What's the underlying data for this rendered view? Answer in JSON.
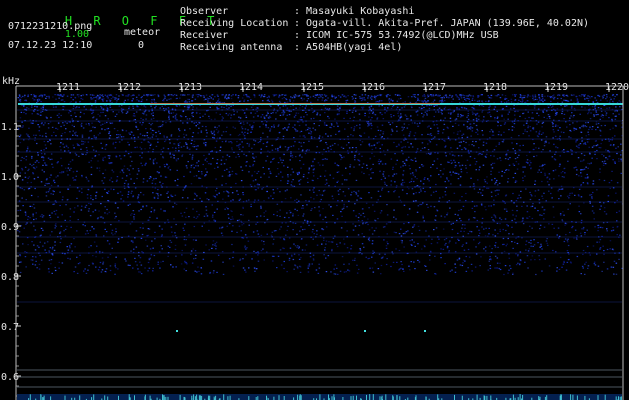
{
  "app": {
    "name": "H R O F F T",
    "version": "1.00"
  },
  "file": {
    "name": "0712231210.png",
    "datetime": "07.12.23 12:10"
  },
  "meteor": {
    "label": "meteor",
    "count": "0"
  },
  "info": [
    {
      "label": "Observer",
      "value": ": Masayuki Kobayashi"
    },
    {
      "label": "Receiving Location",
      "value": ": Ogata-vill. Akita-Pref. JAPAN (139.96E, 40.02N)"
    },
    {
      "label": "Receiver",
      "value": ": ICOM IC-575 53.7492(@LCD)MHz USB"
    },
    {
      "label": "Receiving antenna",
      "value": ": A504HB(yagi 4el)"
    }
  ],
  "axis": {
    "unit": "kHz",
    "time_ticks": [
      "1211",
      "1212",
      "1213",
      "1214",
      "1215",
      "1216",
      "1217",
      "1218",
      "1219",
      "1220"
    ],
    "freq_ticks": [
      "1.1",
      "1.0",
      "0.9",
      "0.8",
      "0.7",
      "0.6"
    ]
  },
  "colors": {
    "background": "#000000",
    "noise": "#1030c0",
    "carrier": "#40e0e0",
    "marker": "#e04040",
    "text": "#e8e8e8"
  }
}
